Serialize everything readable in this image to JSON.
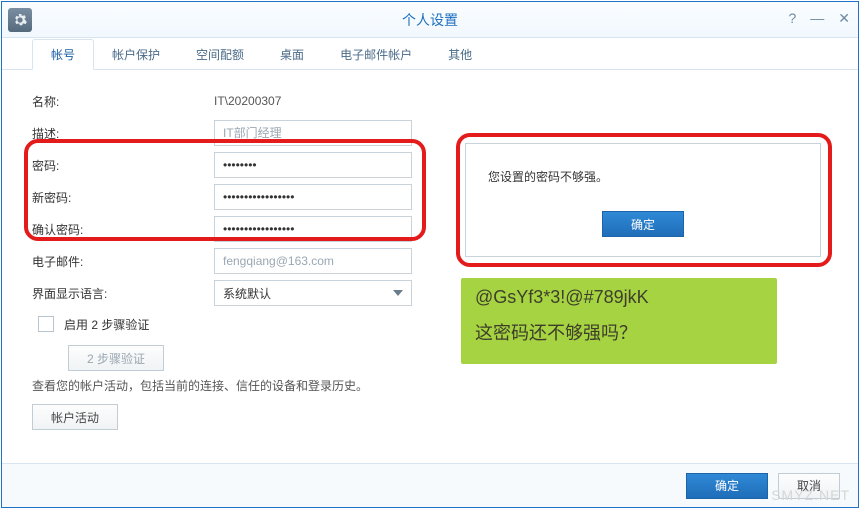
{
  "window": {
    "title": "个人设置"
  },
  "tabs": {
    "account": "帐号",
    "protection": "帐户保护",
    "quota": "空间配额",
    "desktop": "桌面",
    "email": "电子邮件帐户",
    "other": "其他"
  },
  "form": {
    "name_label": "名称:",
    "name_value": "IT\\20200307",
    "desc_label": "描述:",
    "desc_placeholder": "IT部门经理",
    "password_label": "密码:",
    "new_password_label": "新密码:",
    "confirm_password_label": "确认密码:",
    "email_label": "电子邮件:",
    "email_placeholder": "fengqiang@163.com",
    "lang_label": "界面显示语言:",
    "lang_value": "系统默认",
    "two_step_checkbox": "启用 2 步骤验证",
    "two_step_button": "2 步骤验证",
    "activity_hint": "查看您的帐户活动，包括当前的连接、信任的设备和登录历史。",
    "activity_button": "帐户活动"
  },
  "dialog": {
    "message": "您设置的密码不够强。",
    "ok": "确定"
  },
  "sticky": {
    "line1": "@GsYf3*3!@#789jkK",
    "line2": "这密码还不够强吗？"
  },
  "footer": {
    "ok": "确定",
    "cancel": "取消"
  },
  "watermark": "SMYZ.NET"
}
